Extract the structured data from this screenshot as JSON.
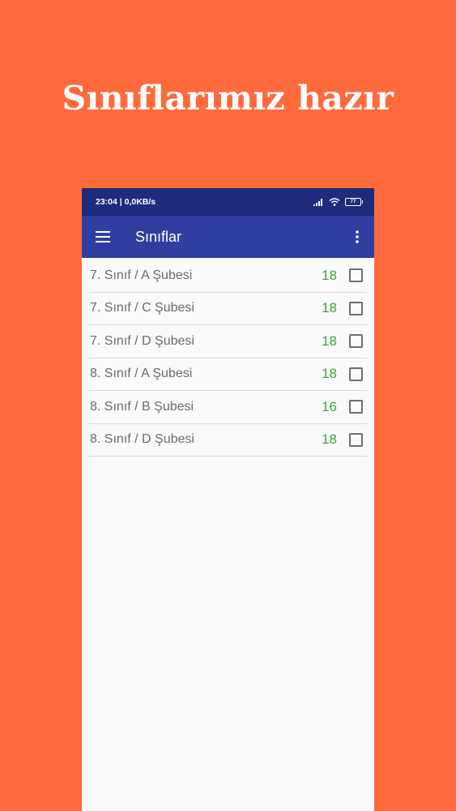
{
  "headline": "Sınıflarımız hazır",
  "status_bar": {
    "time": "23:04 | 0,0KB/s",
    "battery": "77"
  },
  "app_bar": {
    "title": "Sınıflar"
  },
  "classes": [
    {
      "label": "7. Sınıf / A Şubesi",
      "count": "18"
    },
    {
      "label": "7. Sınıf / C Şubesi",
      "count": "18"
    },
    {
      "label": "7. Sınıf / D Şubesi",
      "count": "18"
    },
    {
      "label": "8. Sınıf / A Şubesi",
      "count": "18"
    },
    {
      "label": "8. Sınıf / B Şubesi",
      "count": "16"
    },
    {
      "label": "8. Sınıf / D Şubesi",
      "count": "18"
    }
  ],
  "colors": {
    "background": "#ff6a3c",
    "status_bar": "#1f2b7c",
    "app_bar": "#303f9f",
    "count": "#3aa83a"
  }
}
